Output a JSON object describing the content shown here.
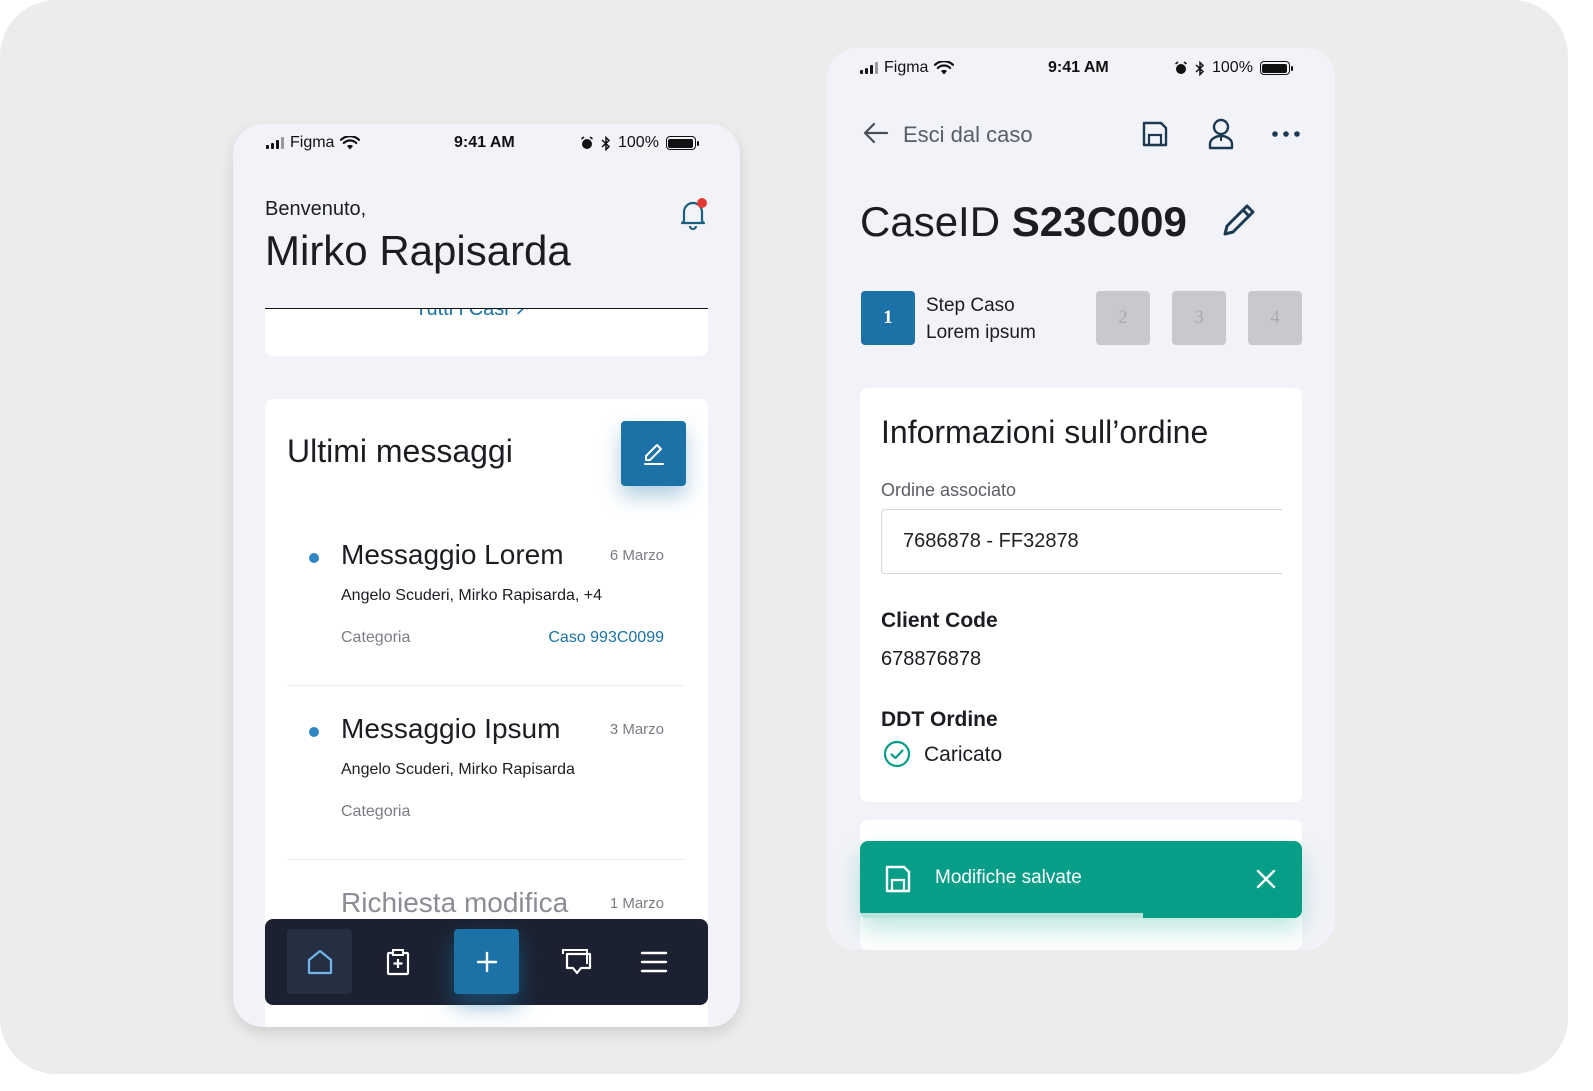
{
  "status_bar": {
    "carrier": "Figma",
    "time": "9:41 AM",
    "battery": "100%"
  },
  "home": {
    "greeting": "Benvenuto,",
    "user_name": "Mirko Rapisarda",
    "all_cases_link": "Tutti i Casi",
    "messages_title": "Ultimi messaggi",
    "messages": [
      {
        "title": "Messaggio Lorem",
        "date": "6 Marzo",
        "people": "Angelo Scuderi, Mirko Rapisarda, +4",
        "category": "Categoria",
        "case": "Caso 993C0099",
        "unread": true
      },
      {
        "title": "Messaggio Ipsum",
        "date": "3 Marzo",
        "people": "Angelo Scuderi, Mirko Rapisarda",
        "category": "Categoria",
        "case": "",
        "unread": true
      },
      {
        "title": "Richiesta modifica",
        "date": "1 Marzo",
        "people": "",
        "category": "",
        "case": "",
        "unread": false
      }
    ],
    "nav_items": [
      "home-icon",
      "clipboard-plus-icon",
      "plus-icon",
      "chat-icon",
      "menu-icon"
    ],
    "active_nav": "home-icon"
  },
  "case": {
    "back_label": "Esci dal caso",
    "title_prefix": "CaseID",
    "case_id": "S23C009",
    "steps": [
      "1",
      "2",
      "3",
      "4"
    ],
    "active_step": "1",
    "step_title": "Step Caso",
    "step_subtitle": "Lorem ipsum",
    "info_title": "Informazioni sull’ordine",
    "order_label": "Ordine associato",
    "order_value": "7686878 - FF32878",
    "client_code_label": "Client Code",
    "client_code_value": "678876878",
    "ddt_label": "DDT Ordine",
    "ddt_status": "Caricato"
  },
  "toast": {
    "message": "Modifiche salvate",
    "progress": 0.64
  },
  "colors": {
    "primary": "#1c72a6",
    "success": "#069e87",
    "nav_bg": "#1b2130",
    "unread_dot": "#2f86c3",
    "notification_dot": "#e53935"
  }
}
